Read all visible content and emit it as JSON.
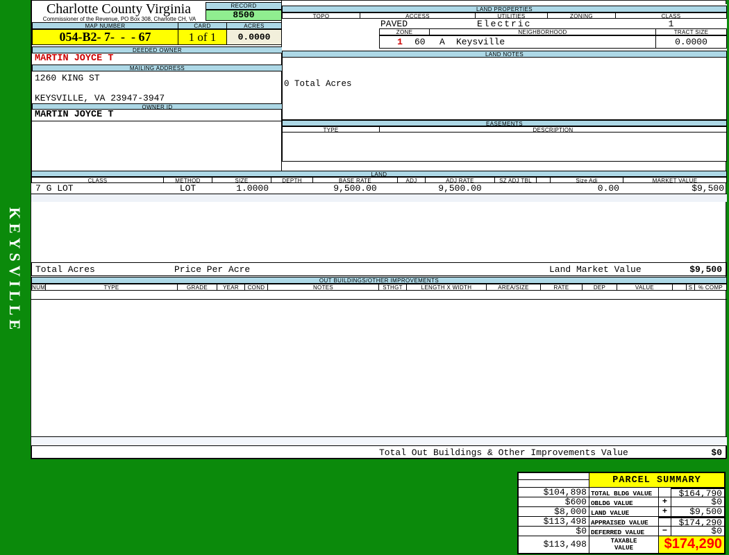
{
  "colors": {
    "page_green": "#0b8a0b",
    "header_blue": "#add8e6",
    "record_green": "#90ee90",
    "highlight_yellow": "#ffff00",
    "acres_cream": "#f2efdb",
    "owner_red": "#cc0000",
    "taxable_red": "#ff0000"
  },
  "sidebar": {
    "district": "KEYSVILLE"
  },
  "header": {
    "county": "Charlotte County Virginia",
    "subtitle": "Commissioner of the Revenue, PO Box 308, Charlotte CH, VA",
    "record_label": "RECORD",
    "record": "8500",
    "map_number_label": "MAP NUMBER",
    "map_number": "054-B2- 7-  -  - 67",
    "card_label": "CARD",
    "card": "1 of 1",
    "acres_label": "ACRES",
    "acres": "0.0000"
  },
  "owner": {
    "deeded_owner_label": "DEEDED OWNER",
    "deeded_owner": "MARTIN JOYCE T",
    "mailing_label": "MAILING ADDRESS",
    "address1": "1260 KING ST",
    "address2": "KEYSVILLE, VA 23947-3947",
    "owner_id_label": "OWNER ID",
    "owner_id": "MARTIN JOYCE T"
  },
  "land_properties": {
    "title": "LAND PROPERTIES",
    "columns": [
      "TOPO",
      "ACCESS",
      "UTILITIES",
      "ZONING",
      "CLASS"
    ],
    "topo": "",
    "access": "PAVED",
    "utilities": "Electric",
    "zoning": "",
    "class": "1",
    "zone_label": "ZONE",
    "zone": "1",
    "zone_code": "60",
    "zone_suffix": "A",
    "neighborhood_label": "NEIGHBORHOOD",
    "neighborhood": "Keysville",
    "tract_size_label": "TRACT SIZE",
    "tract_size": "0.0000"
  },
  "land_notes": {
    "title": "LAND NOTES",
    "note": "0 Total Acres"
  },
  "easements": {
    "title": "EASEMENTS",
    "type_label": "TYPE",
    "description_label": "DESCRIPTION"
  },
  "land": {
    "title": "LAND",
    "columns": [
      "CLASS",
      "METHOD",
      "SIZE",
      "DEPTH",
      "BASE RATE",
      "ADJ",
      "ADJ RATE",
      "SZ ADJ TBL",
      "",
      "Size Adj",
      "MARKET VALUE"
    ],
    "row": {
      "class": "7 G LOT",
      "method": "LOT",
      "size": "1.0000",
      "depth": "",
      "base_rate": "9,500.00",
      "adj": "",
      "adj_rate": "9,500.00",
      "sz_adj_tbl": "",
      "size_adj": "0.00",
      "market_value": "$9,500"
    },
    "total_acres_label": "Total Acres",
    "price_per_acre_label": "Price Per Acre",
    "land_market_value_label": "Land Market Value",
    "land_market_value": "$9,500"
  },
  "out_buildings": {
    "title": "OUT BUILDINGS/OTHER IMPROVEMENTS",
    "columns": [
      "NUM",
      "TYPE",
      "GRADE",
      "YEAR",
      "COND",
      "NOTES",
      "STHGT",
      "LENGTH X WIDTH",
      "AREA/SIZE",
      "RATE",
      "DEP",
      "VALUE",
      "",
      "S",
      "% COMP"
    ],
    "total_label": "Total Out Buildings & Other Improvements Value",
    "total_value": "$0"
  },
  "parcel_summary": {
    "title": "PARCEL SUMMARY",
    "rows": [
      {
        "prev": "$104,898",
        "label": "TOTAL BLDG VALUE",
        "op": "",
        "value": "$164,790"
      },
      {
        "prev": "$600",
        "label": "OBLDG VALUE",
        "op": "+",
        "value": "$0"
      },
      {
        "prev": "$8,000",
        "label": "LAND VALUE",
        "op": "+",
        "value": "$9,500"
      },
      {
        "prev": "$113,498",
        "label": "APPRAISED VALUE",
        "op": "",
        "value": "$174,290"
      },
      {
        "prev": "$0",
        "label": "DEFERRED VALUE",
        "op": "−",
        "value": "$0"
      }
    ],
    "taxable": {
      "prev": "$113,498",
      "label1": "TAXABLE",
      "label2": "VALUE",
      "value": "$174,290"
    }
  }
}
